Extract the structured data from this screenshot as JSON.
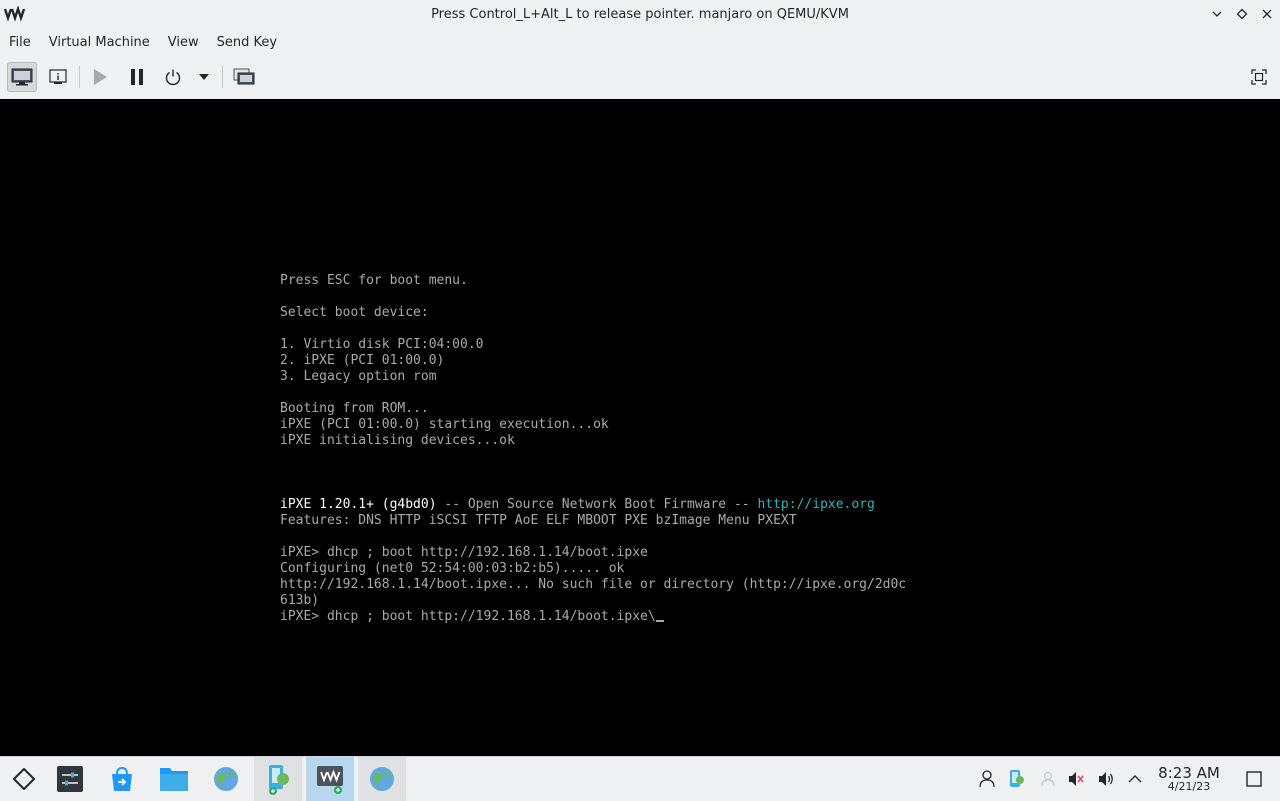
{
  "window": {
    "title": "Press Control_L+Alt_L to release pointer. manjaro on QEMU/KVM",
    "logo_icon": "virt-manager-logo",
    "controls": [
      "minimize-icon",
      "maximize-icon",
      "close-icon"
    ]
  },
  "menu": {
    "file": "File",
    "virtual_machine": "Virtual Machine",
    "view": "View",
    "send_key": "Send Key"
  },
  "toolbar": {
    "icons": [
      "console-icon",
      "details-icon",
      "run-icon",
      "pause-icon",
      "power-icon",
      "chevron-down-icon",
      "snapshots-icon",
      "fullscreen-icon"
    ]
  },
  "console": {
    "line1": "Press ESC for boot menu.",
    "line2": "Select boot device:",
    "line3": "1. Virtio disk PCI:04:00.0",
    "line4": "2. iPXE (PCI 01:00.0)",
    "line5": "3. Legacy option rom",
    "line6": "Booting from ROM...",
    "line7": "iPXE (PCI 01:00.0) starting execution...ok",
    "line8": "iPXE initialising devices...ok",
    "banner_bright": "iPXE 1.20.1+ (g4bd0)",
    "banner_mid": " -- Open Source Network Boot Firmware -- ",
    "banner_link": "http://ipxe.org",
    "features": "Features: DNS HTTP iSCSI TFTP AoE ELF MBOOT PXE bzImage Menu PXEXT",
    "cmd1": "iPXE> dhcp ; boot http://192.168.1.14/boot.ipxe",
    "configuring": "Configuring (net0 52:54:00:03:b2:b5)..... ok",
    "error1": "http://192.168.1.14/boot.ipxe... No such file or directory (http://ipxe.org/2d0c",
    "error2": "613b)",
    "cmd2": "iPXE> dhcp ; boot http://192.168.1.14/boot.ipxe\\"
  },
  "taskbar": {
    "launchers": [
      "application-launcher-icon",
      "system-settings-icon",
      "discover-store-icon",
      "file-manager-icon",
      "web-browser-icon",
      "network-manager-app-icon",
      "virt-manager-icon",
      "web-browser-window-icon"
    ],
    "tray": [
      "user-icon",
      "network-icon",
      "display-icon",
      "mute-icon",
      "volume-icon",
      "chevron-up-icon"
    ],
    "clock_time": "8:23 AM",
    "clock_date": "4/21/23",
    "show_desktop_icon": "show-desktop-icon"
  },
  "colors": {
    "accent": "#3daee9",
    "console_text": "#aaaaaa",
    "console_bright": "#ffffff",
    "console_link": "#33b2b2"
  }
}
